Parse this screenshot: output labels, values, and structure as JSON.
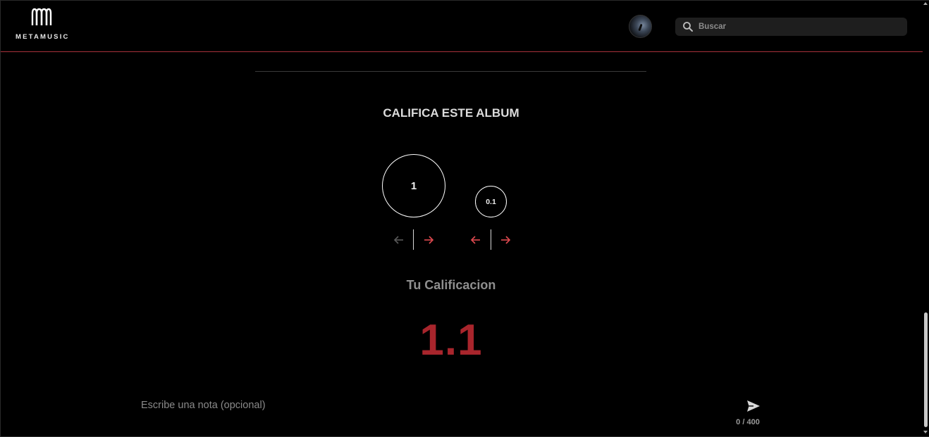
{
  "header": {
    "logo_text": "METAMUSIC",
    "search": {
      "placeholder": "Buscar",
      "value": ""
    }
  },
  "rating": {
    "title": "CALIFICA ESTE ALBUM",
    "integer_value": "1",
    "decimal_value": "0.1",
    "your_rating_label": "Tu Calificacion",
    "score": "1.1"
  },
  "note": {
    "placeholder": "Escribe una nota (opcional)",
    "value": "",
    "counter": "0 / 400"
  },
  "colors": {
    "accent": "#a8252c",
    "arrow_active": "#e04a50",
    "arrow_disabled": "#5a5a5a",
    "background": "#000000"
  },
  "icons": {
    "search": "search-icon",
    "send": "send-icon",
    "prev": "arrow-left-icon",
    "next": "arrow-right-icon"
  }
}
